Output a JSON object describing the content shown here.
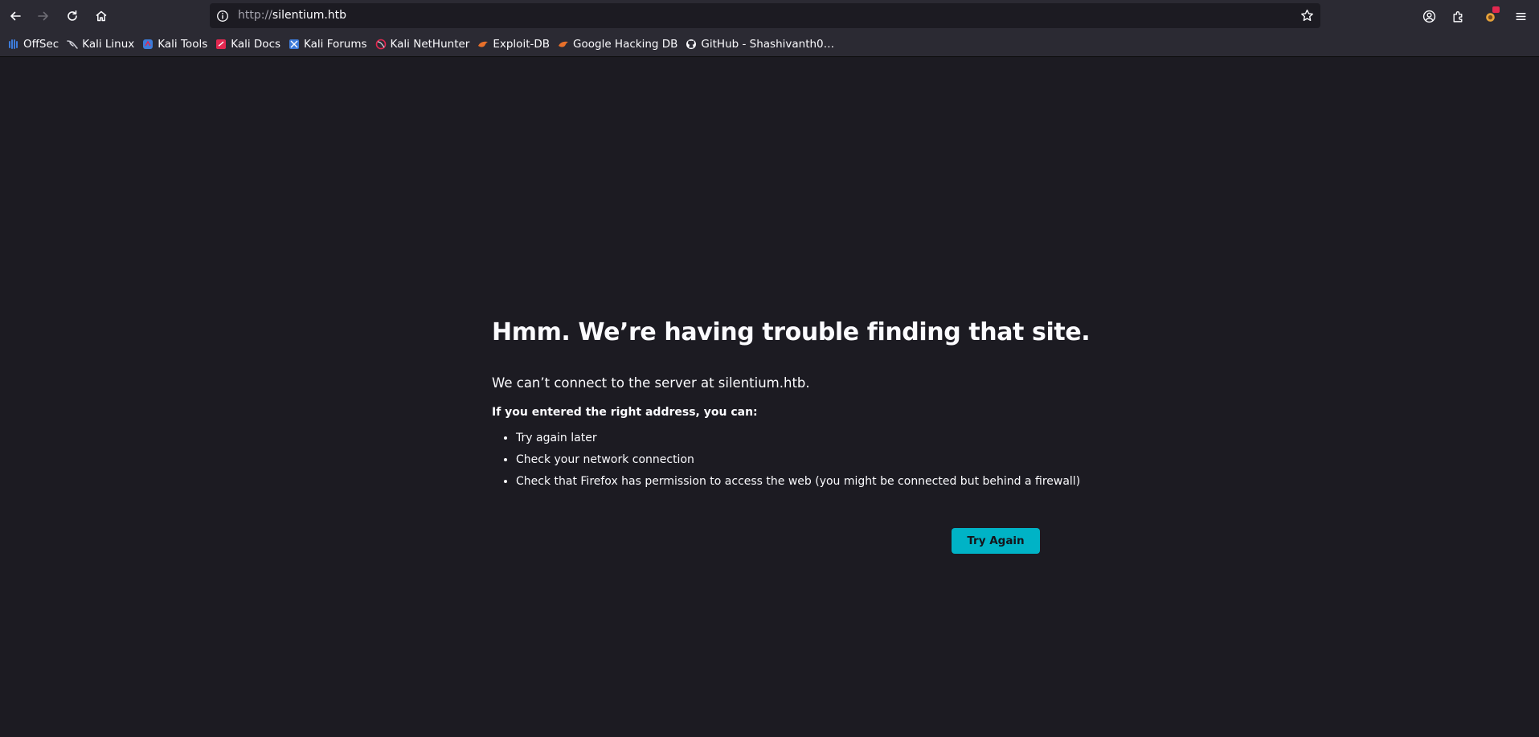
{
  "browser": {
    "url_scheme": "http://",
    "url_host": "silentium.htb"
  },
  "toolbar": {
    "icons": [
      "back-arrow-icon",
      "forward-arrow-icon",
      "reload-icon",
      "home-icon",
      "site-info-icon",
      "bookmark-star-icon",
      "account-icon",
      "extensions-icon",
      "extension-badge-icon",
      "hamburger-menu-icon"
    ]
  },
  "bookmarks": [
    {
      "label": "OffSec",
      "icon": "offsec-icon",
      "color": "#3d7bd9"
    },
    {
      "label": "Kali Linux",
      "icon": "kali-dragon-icon",
      "color": "#cfcfd8"
    },
    {
      "label": "Kali Tools",
      "icon": "kali-tools-icon",
      "color": "#3d7bd9"
    },
    {
      "label": "Kali Docs",
      "icon": "kali-docs-icon",
      "color": "#e22850"
    },
    {
      "label": "Kali Forums",
      "icon": "kali-forums-icon",
      "color": "#3d7bd9"
    },
    {
      "label": "Kali NetHunter",
      "icon": "nethunter-icon",
      "color": "#e22850"
    },
    {
      "label": "Exploit-DB",
      "icon": "exploit-db-icon",
      "color": "#e8702a"
    },
    {
      "label": "Google Hacking DB",
      "icon": "ghdb-icon",
      "color": "#e8702a"
    },
    {
      "label": "GitHub - Shashivanth0…",
      "icon": "github-icon",
      "color": "#fbfbfe"
    }
  ],
  "error": {
    "title": "Hmm. We’re having trouble finding that site.",
    "description": "We can’t connect to the server at silentium.htb.",
    "subheading": "If you entered the right address, you can:",
    "suggestions": [
      "Try again later",
      "Check your network connection",
      "Check that Firefox has permission to access the web (you might be connected but behind a firewall)"
    ],
    "button_label": "Try Again"
  },
  "colors": {
    "page_background": "#1c1b22",
    "chrome_background": "#2b2a33",
    "accent_button": "#00b3c6"
  }
}
